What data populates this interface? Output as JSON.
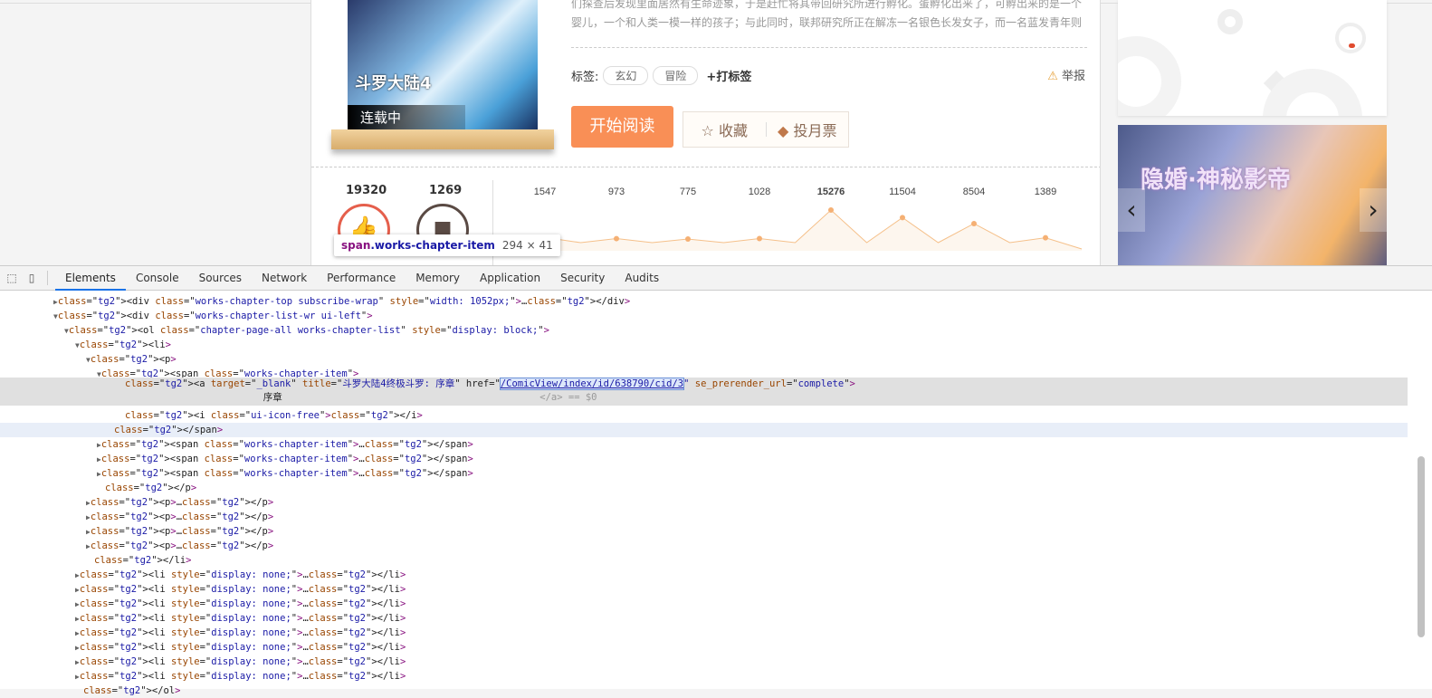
{
  "comic": {
    "status": "连载中",
    "logo_text": "斗罗大陆4",
    "desc_line1": "们探查后发现里面居然有生命迹象，于是赶忙将其带回研究所进行孵化。蛋孵化出来了，可孵出来的是一个",
    "desc_line2": "婴儿，一个和人类一模一样的孩子；与此同时，联邦研究所正在解冻一名银色长发女子，而一名蓝发青年则",
    "tags_label": "标签:",
    "tags": [
      "玄幻",
      "冒险"
    ],
    "add_tag": "+打标签",
    "report": "举报",
    "read_button": "开始阅读",
    "favorite": "收藏",
    "vote": "投月票",
    "likes": "19320",
    "dislikes": "1269",
    "accent": "#f98f56"
  },
  "chart_data": {
    "type": "line",
    "values": [
      1547,
      973,
      775,
      1028,
      15276,
      11504,
      8504,
      1389
    ],
    "highlight_index": 4,
    "color": "#f5c08a"
  },
  "sidebar": {
    "banner_title": "隐婚·神秘影帝"
  },
  "tooltip": {
    "tag": "span",
    "cls": ".works-chapter-item",
    "size": "294 × 41"
  },
  "devtools": {
    "tabs": [
      "Elements",
      "Console",
      "Sources",
      "Network",
      "Performance",
      "Memory",
      "Application",
      "Security",
      "Audits"
    ],
    "active_tab": "Elements"
  },
  "dom": {
    "l1": "<div class=\"works-chapter-top subscribe-wrap\" style=\"width: 1052px;\">…</div>",
    "l2": "<div class=\"works-chapter-list-wr ui-left\">",
    "l3": "<ol class=\"chapter-page-all works-chapter-list\" style=\"display: block;\">",
    "l4": "<li>",
    "l5": "<p>",
    "l6": "<span class=\"works-chapter-item\">",
    "a_pre": "<a target=\"_blank\" title=\"斗罗大陆4终极斗罗: 序章\" href=\"",
    "a_href": "/ComicView/index/id/638790/cid/3",
    "a_post": "\" se_prerender_url=\"complete\">",
    "a_text": "序章",
    "a_close": "</a> == $0",
    "l8": "<i class=\"ui-icon-free\"></i>",
    "l9": "</span>",
    "span_collapsed": "<span class=\"works-chapter-item\">…</span>",
    "l13": "</p>",
    "p_collapsed": "<p>…</p>",
    "l18": "</li>",
    "li_hidden": "<li style=\"display: none;\">…</li>",
    "l27": "</ol>"
  }
}
